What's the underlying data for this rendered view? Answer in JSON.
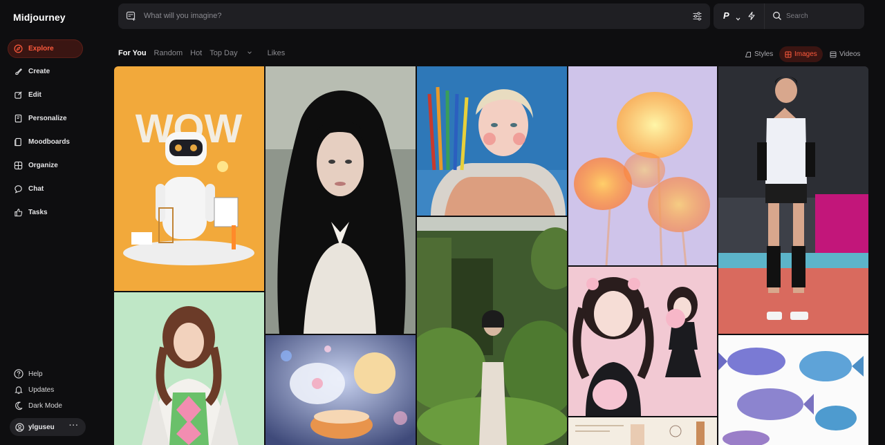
{
  "app": {
    "name": "Midjourney"
  },
  "sidebar": {
    "items": [
      {
        "label": "Explore",
        "icon": "compass-icon",
        "active": true
      },
      {
        "label": "Create",
        "icon": "brush-icon"
      },
      {
        "label": "Edit",
        "icon": "edit-icon"
      },
      {
        "label": "Personalize",
        "icon": "personalize-icon"
      },
      {
        "label": "Moodboards",
        "icon": "moodboard-icon"
      },
      {
        "label": "Organize",
        "icon": "grid-icon"
      },
      {
        "label": "Chat",
        "icon": "chat-icon"
      },
      {
        "label": "Tasks",
        "icon": "thumbs-up-icon"
      }
    ],
    "bottom": [
      {
        "label": "Help",
        "icon": "help-icon"
      },
      {
        "label": "Updates",
        "icon": "bell-icon"
      },
      {
        "label": "Dark Mode",
        "icon": "moon-icon"
      }
    ],
    "user": {
      "name": "ylguseu",
      "more": "···"
    }
  },
  "prompt": {
    "placeholder": "What will you imagine?"
  },
  "tools": {
    "personalize_label": "P",
    "search_placeholder": "Search"
  },
  "tabs": [
    {
      "label": "For You",
      "active": true
    },
    {
      "label": "Random"
    },
    {
      "label": "Hot"
    },
    {
      "label": "Top Day",
      "dropdown": true
    },
    {
      "label": "Likes"
    }
  ],
  "views": [
    {
      "label": "Styles"
    },
    {
      "label": "Images",
      "active": true
    },
    {
      "label": "Videos"
    }
  ],
  "gallery": {
    "images": [
      {
        "alt": "WOW robot illustration"
      },
      {
        "alt": "Woman with dark curly hair"
      },
      {
        "alt": "Blonde figure with colored pencils"
      },
      {
        "alt": "Orange translucent flowers"
      },
      {
        "alt": "Volleyball player"
      },
      {
        "alt": "Woman in argyle vest"
      },
      {
        "alt": "Glass flower and moon"
      },
      {
        "alt": "Topiary garden figure"
      },
      {
        "alt": "Pink fashion collage"
      },
      {
        "alt": "Fish illustrations"
      },
      {
        "alt": "Sketchbook page"
      }
    ]
  },
  "colors": {
    "accent": "#ff5a3c",
    "background": "#0e0e10",
    "panel": "#1f1f23"
  }
}
